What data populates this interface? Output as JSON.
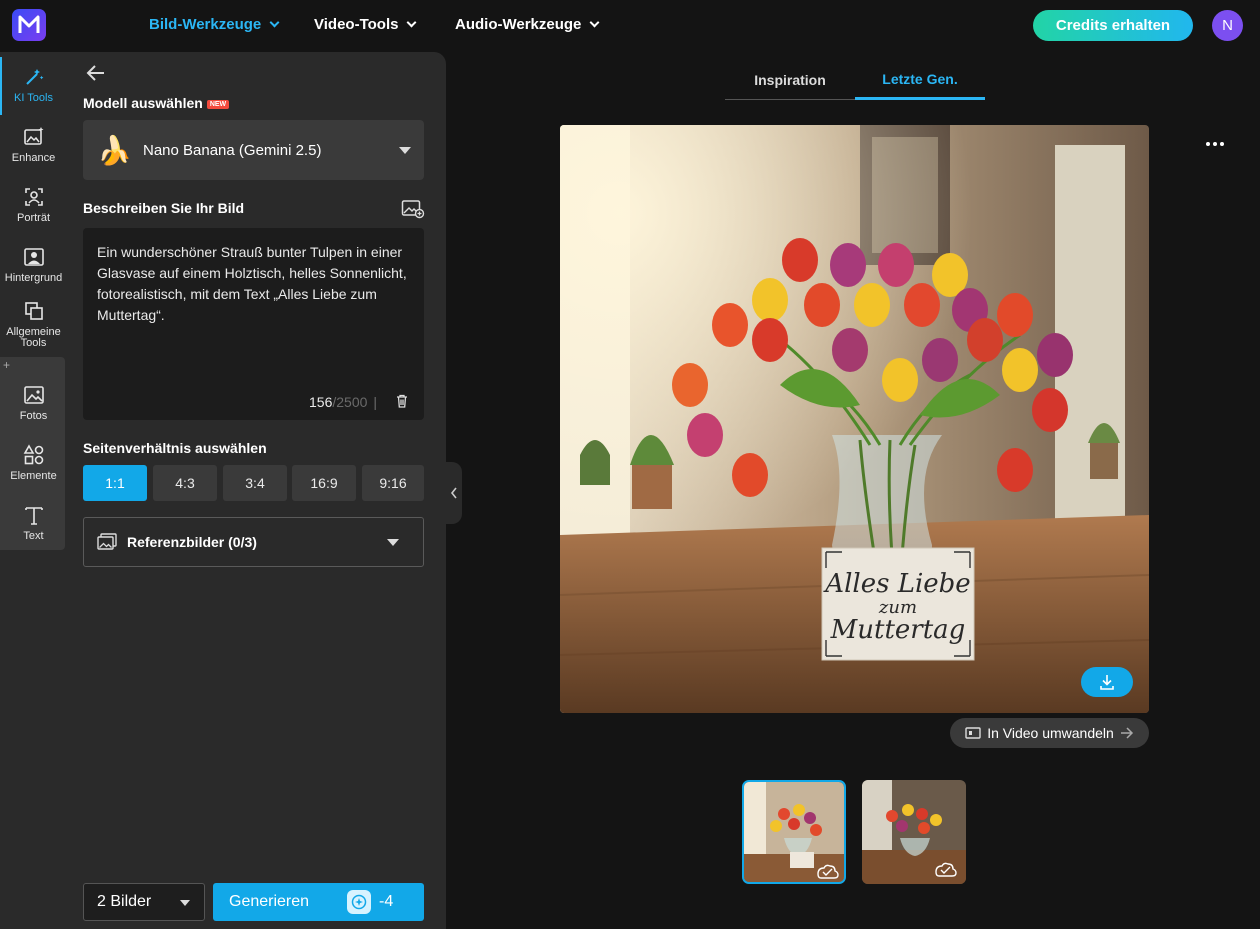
{
  "nav": {
    "items": [
      {
        "label": "Bild-Werkzeuge"
      },
      {
        "label": "Video-Tools"
      },
      {
        "label": "Audio-Werkzeuge"
      }
    ],
    "credits_label": "Credits erhalten",
    "avatar_initial": "N"
  },
  "rail": {
    "items": [
      {
        "label": "KI Tools"
      },
      {
        "label": "Enhance"
      },
      {
        "label": "Porträt"
      },
      {
        "label": "Hintergrund"
      },
      {
        "label": "Allgemeine Tools"
      },
      {
        "label": "Fotos"
      },
      {
        "label": "Elemente"
      },
      {
        "label": "Text"
      }
    ]
  },
  "panel": {
    "model_heading": "Modell auswählen",
    "new_badge": "NEW",
    "model_name": "Nano Banana (Gemini 2.5)",
    "model_emoji": "🍌",
    "describe_heading": "Beschreiben Sie Ihr Bild",
    "prompt": "Ein wunderschöner Strauß bunter Tulpen in einer Glasvase auf einem Holztisch, helles Sonnenlicht, fotorealistisch, mit dem Text „Alles Liebe zum Muttertag“.",
    "char_count": "156",
    "char_max": "/2500",
    "char_sep": "|",
    "ratio_heading": "Seitenverhältnis auswählen",
    "ratios": [
      {
        "label": "1:1"
      },
      {
        "label": "4:3"
      },
      {
        "label": "3:4"
      },
      {
        "label": "16:9"
      },
      {
        "label": "9:16"
      }
    ],
    "reference_label": "Referenzbilder (0/3)",
    "count_label": "2 Bilder",
    "generate_label": "Generieren",
    "generate_cost": "-4"
  },
  "main": {
    "tabs": [
      {
        "label": "Inspiration"
      },
      {
        "label": "Letzte Gen."
      }
    ],
    "card_line1": "Alles Liebe",
    "card_line2": "zum",
    "card_line3": "Muttertag",
    "video_button": "In Video umwandeln"
  },
  "colors": {
    "accent": "#12a8e8",
    "panel": "#2a2a2a",
    "background": "#141414"
  }
}
